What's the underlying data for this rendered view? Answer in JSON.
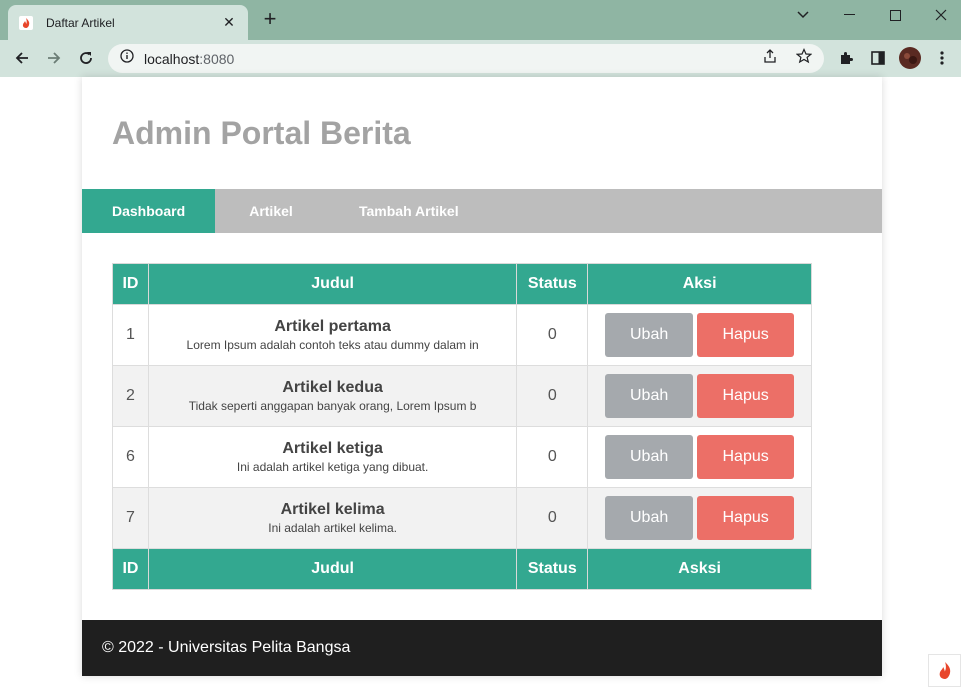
{
  "browser": {
    "tab_title": "Daftar Artikel",
    "url_host": "localhost",
    "url_port": ":8080"
  },
  "site": {
    "title": "Admin Portal Berita",
    "nav": [
      "Dashboard",
      "Artikel",
      "Tambah Artikel"
    ]
  },
  "table": {
    "headers": [
      "ID",
      "Judul",
      "Status",
      "Aksi"
    ],
    "footers": [
      "ID",
      "Judul",
      "Status",
      "Asksi"
    ],
    "rows": [
      {
        "id": "1",
        "title": "Artikel pertama",
        "desc": "Lorem Ipsum adalah contoh teks atau dummy dalam in",
        "status": "0"
      },
      {
        "id": "2",
        "title": "Artikel kedua",
        "desc": "Tidak seperti anggapan banyak orang, Lorem Ipsum b",
        "status": "0"
      },
      {
        "id": "6",
        "title": "Artikel ketiga",
        "desc": "Ini adalah artikel ketiga yang dibuat.",
        "status": "0"
      },
      {
        "id": "7",
        "title": "Artikel kelima",
        "desc": "Ini adalah artikel kelima.",
        "status": "0"
      }
    ],
    "edit_label": "Ubah",
    "delete_label": "Hapus"
  },
  "footer": {
    "text": "© 2022 - Universitas Pelita Bangsa"
  },
  "colors": {
    "accent": "#33a890",
    "nav_bg": "#bdbdbd",
    "edit_btn": "#a5a9ad",
    "delete_btn": "#ec6f67",
    "footer_bg": "#1f1f1f"
  }
}
